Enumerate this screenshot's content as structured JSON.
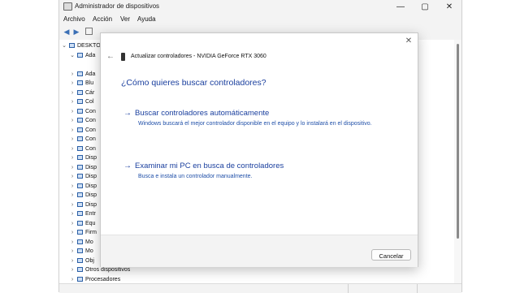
{
  "window": {
    "title": "Administrador de dispositivos",
    "controls": {
      "minimize": "—",
      "maximize": "▢",
      "close": "✕"
    }
  },
  "menu": [
    "Archivo",
    "Acción",
    "Ver",
    "Ayuda"
  ],
  "tree": {
    "root": "DESKTO",
    "partial_items": [
      "Ada",
      "Ada",
      "Blu",
      "Cár",
      "Col",
      "Con",
      "Con",
      "Con",
      "Con",
      "Con",
      "Disp",
      "Disp",
      "Disp",
      "Disp",
      "Disp",
      "Disp",
      "Entr",
      "Equ",
      "Firm",
      "Mo",
      "Mo",
      "Obj"
    ],
    "items": [
      "Otros dispositivos",
      "Procesadores"
    ]
  },
  "dialog": {
    "title": "Actualizar controladores - NVIDIA GeForce RTX 3060",
    "heading": "¿Cómo quieres buscar controladores?",
    "option1": {
      "title": "Buscar controladores automáticamente",
      "desc": "Windows buscará el mejor controlador disponible en el equipo y lo instalará en el dispositivo."
    },
    "option2": {
      "title": "Examinar mi PC en busca de controladores",
      "desc": "Busca e instala un controlador manualmente."
    },
    "cancel": "Cancelar",
    "arrow": "→",
    "close": "✕",
    "back": "←"
  },
  "colors": {
    "accent": "#1a3f9e",
    "link_desc": "#1f4fa8",
    "window_bg": "#f3f3f3"
  }
}
